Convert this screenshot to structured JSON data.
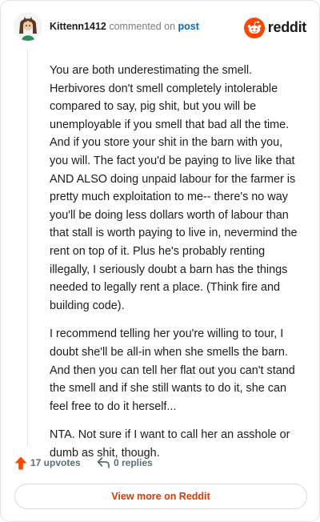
{
  "comment": {
    "username": "Kittenn1412",
    "action_text": "commented on",
    "post_link": "post",
    "brand": "reddit",
    "paragraphs": [
      "You are both underestimating the smell. Herbivores don't smell completely intolerable compared to say, pig shit, but you will be unemployable if you smell that bad all the time. And if you store your shit in the barn with you, you will. The fact you'd be paying to live like that AND ALSO doing unpaid labour for the farmer is pretty much exploitation to me-- there's no way you'll be doing less dollars worth of labour than that stall is worth paying to live in, nevermind the rent on top of it. Plus he's probably renting illegally, I seriously doubt a barn has the things needed to legally rent a place. (Think fire and building code).",
      "I recommend telling her you're willing to tour, I doubt she'll be all-in when she smells the barn. And then you can tell her flat out you can't stand the smell and if she still wants to do it, she can feel free to do it herself...",
      "NTA. Not sure if I want to call her an asshole or dumb as shit, though."
    ],
    "upvotes": "17 upvotes",
    "replies": "0 replies",
    "view_more": "View more on Reddit"
  },
  "icons": {
    "avatar": "avatar-icon",
    "logo": "reddit-logo-icon",
    "upvote": "upvote-arrow-icon",
    "reply": "reply-arrow-icon"
  },
  "colors": {
    "accent": "#ff4500",
    "link": "#0a66b2",
    "view_more": "#d93a00",
    "muted": "#576f76"
  }
}
